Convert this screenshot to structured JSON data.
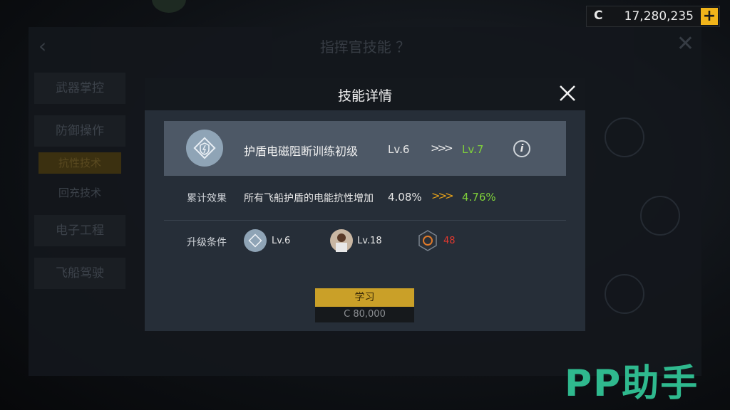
{
  "currency": {
    "symbol": "C",
    "amount": "17,280,235",
    "add_label": "+"
  },
  "background_screen": {
    "title": "指挥官技能 ？",
    "sidebar": [
      "武器掌控",
      "防御操作",
      "抗性技术",
      "回充技术",
      "电子工程",
      "飞船驾驶"
    ],
    "active_index": 2
  },
  "modal": {
    "title": "技能详情",
    "skill": {
      "name": "护盾电磁阻断训练初级",
      "level_from": "Lv.6",
      "arrows": ">>>",
      "level_to": "Lv.7",
      "info": "i"
    },
    "effect": {
      "label": "累计效果",
      "description": "所有飞船护盾的电能抗性增加",
      "value_from": "4.08%",
      "arrows": ">>>",
      "value_to": "4.76%"
    },
    "requirements": {
      "label": "升级条件",
      "skill_level": "Lv.6",
      "commander_level": "Lv.18",
      "item_count": "48"
    },
    "learn_button": "学习",
    "cost": "C  80,000"
  },
  "watermark": "PP助手",
  "colors": {
    "accent_gold": "#caa028",
    "level_green": "#7fd03a",
    "warning_red": "#e0382f",
    "watermark_green": "#2fb98e"
  }
}
